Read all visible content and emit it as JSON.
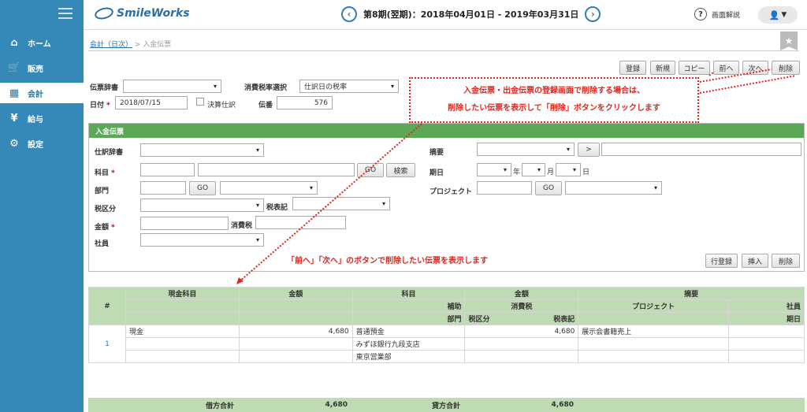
{
  "nav": {
    "items": [
      {
        "label": "ホーム",
        "icon": "home-icon"
      },
      {
        "label": "販売",
        "icon": "cart-icon"
      },
      {
        "label": "会計",
        "icon": "calculator-icon"
      },
      {
        "label": "給与",
        "icon": "money-bag-icon"
      },
      {
        "label": "設定",
        "icon": "gear-icon"
      }
    ]
  },
  "header": {
    "logo": "SmileWorks",
    "period": "第8期(翌期)：2018年04月01日 - 2019年03月31日",
    "prev": "‹",
    "next": "›",
    "help": "画面解説"
  },
  "breadcrumb": {
    "parent": "会計（日次）",
    "sep": " > ",
    "current": "入金伝票"
  },
  "toolbar": [
    "登録",
    "新規",
    "コピー",
    "前へ",
    "次へ",
    "削除"
  ],
  "form": {
    "dict_label": "伝票辞書",
    "tax_select_label": "消費税率選択",
    "tax_select_value": "仕訳日の税率",
    "date_label": "日付",
    "date_value": "2018/07/15",
    "closing_label": "決算仕訳",
    "slip_no_label": "伝番",
    "slip_no_value": "576"
  },
  "panel": {
    "title": "入金伝票",
    "entry_dict_label": "仕訳辞書",
    "summary_label": "摘要",
    "summary_btn": ">",
    "account_label": "科目",
    "go": "GO",
    "search": "検索",
    "due_label": "期日",
    "year": "年",
    "month": "月",
    "day": "日",
    "dept_label": "部門",
    "project_label": "プロジェクト",
    "taxcat_label": "税区分",
    "taxnote_label": "税表記",
    "amount_label": "金額",
    "tax_label": "消費税",
    "staff_label": "社員",
    "row_register": "行登録",
    "row_insert": "挿入",
    "row_delete": "削除"
  },
  "annotations": {
    "box_line1": "入金伝票・出金伝票の登録画面で削除する場合は、",
    "box_line2": "削除したい伝票を表示して「削除」ボタンをクリックします",
    "nav_hint": "「前へ」「次へ」のボタンで削除したい伝票を表示します"
  },
  "table": {
    "h1": [
      "#",
      "現金科目",
      "金額",
      "科目",
      "金額",
      "摘要"
    ],
    "h2": [
      "補助",
      "消費税",
      "プロジェクト",
      "社員"
    ],
    "h3": [
      "部門",
      "税区分",
      "税表記",
      "期日"
    ],
    "row_no": "1",
    "cash_account": "現金",
    "debit_amount": "4,680",
    "account": "普通預金",
    "credit_amount": "4,680",
    "summary": "展示会書籍売上",
    "sub_account": "みずほ銀行九段支店",
    "department": "東京営業部"
  },
  "totals": {
    "debit_label": "借方合計",
    "debit_value": "4,680",
    "credit_label": "貸方合計",
    "credit_value": "4,680"
  },
  "colors": {
    "sidebar": "#3589b8",
    "panel_green": "#5ba857",
    "annotation_red": "#e0261f"
  }
}
